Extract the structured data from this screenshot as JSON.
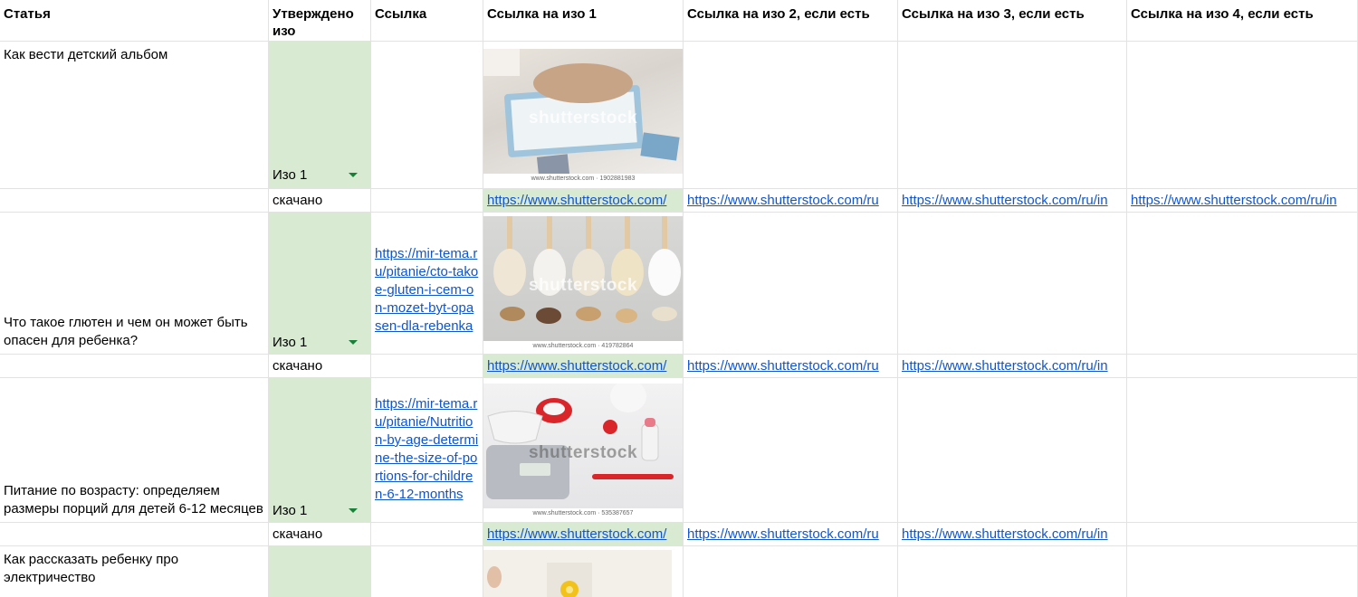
{
  "headers": {
    "c1": "Статья",
    "c2": "Утверждено изо",
    "c3": "Ссылка",
    "c4": "Ссылка на изо 1",
    "c5": "Ссылка на изо 2, если есть",
    "c6": "Ссылка на изо 3, если есть",
    "c7": "Ссылка на изо 4, если есть"
  },
  "rows": [
    {
      "title": "Как вести детский альбом",
      "approved": "Изо 1",
      "status": "скачано",
      "link": "",
      "image": {
        "icon": "photo-album-thumbnail-icon",
        "watermark": "shutterstock",
        "stock_id": "www.shutterstock.com · 1902881983"
      },
      "img_links": [
        "https://www.shutterstock.com/",
        "https://www.shutterstock.com/ru",
        "https://www.shutterstock.com/ru/in",
        "https://www.shutterstock.com/ru/in"
      ]
    },
    {
      "title": "Что такое глютен и чем он может быть опасен для ребенка?",
      "approved": "Изо 1",
      "status": "скачано",
      "link": "https://mir-tema.ru/pitanie/cto-takoe-gluten-i-cem-on-mozet-byt-opasen-dla-rebenka",
      "image": {
        "icon": "flour-spoons-thumbnail-icon",
        "watermark": "shutterstock",
        "stock_id": "www.shutterstock.com · 419782864"
      },
      "img_links": [
        "https://www.shutterstock.com/",
        "https://www.shutterstock.com/ru",
        "https://www.shutterstock.com/ru/in"
      ]
    },
    {
      "title": "Питание по возрасту: определяем размеры порций для детей 6-12 месяцев",
      "approved": "Изо 1",
      "status": "скачано",
      "link": "https://mir-tema.ru/pitanie/Nutrition-by-age-determine-the-size-of-portions-for-children-6-12-months",
      "image": {
        "icon": "kitchen-scale-thumbnail-icon",
        "watermark": "shutterstock",
        "stock_id": "www.shutterstock.com · 535387657"
      },
      "img_links": [
        "https://www.shutterstock.com/",
        "https://www.shutterstock.com/ru",
        "https://www.shutterstock.com/ru/in"
      ]
    },
    {
      "title": "Как рассказать ребенку про электричество",
      "image": {
        "icon": "light-bulb-thumbnail-icon"
      }
    }
  ],
  "colors": {
    "approved_bg": "#d9ead3",
    "link": "#1155cc",
    "caret": "#188038",
    "grid": "#e2e2e2"
  }
}
